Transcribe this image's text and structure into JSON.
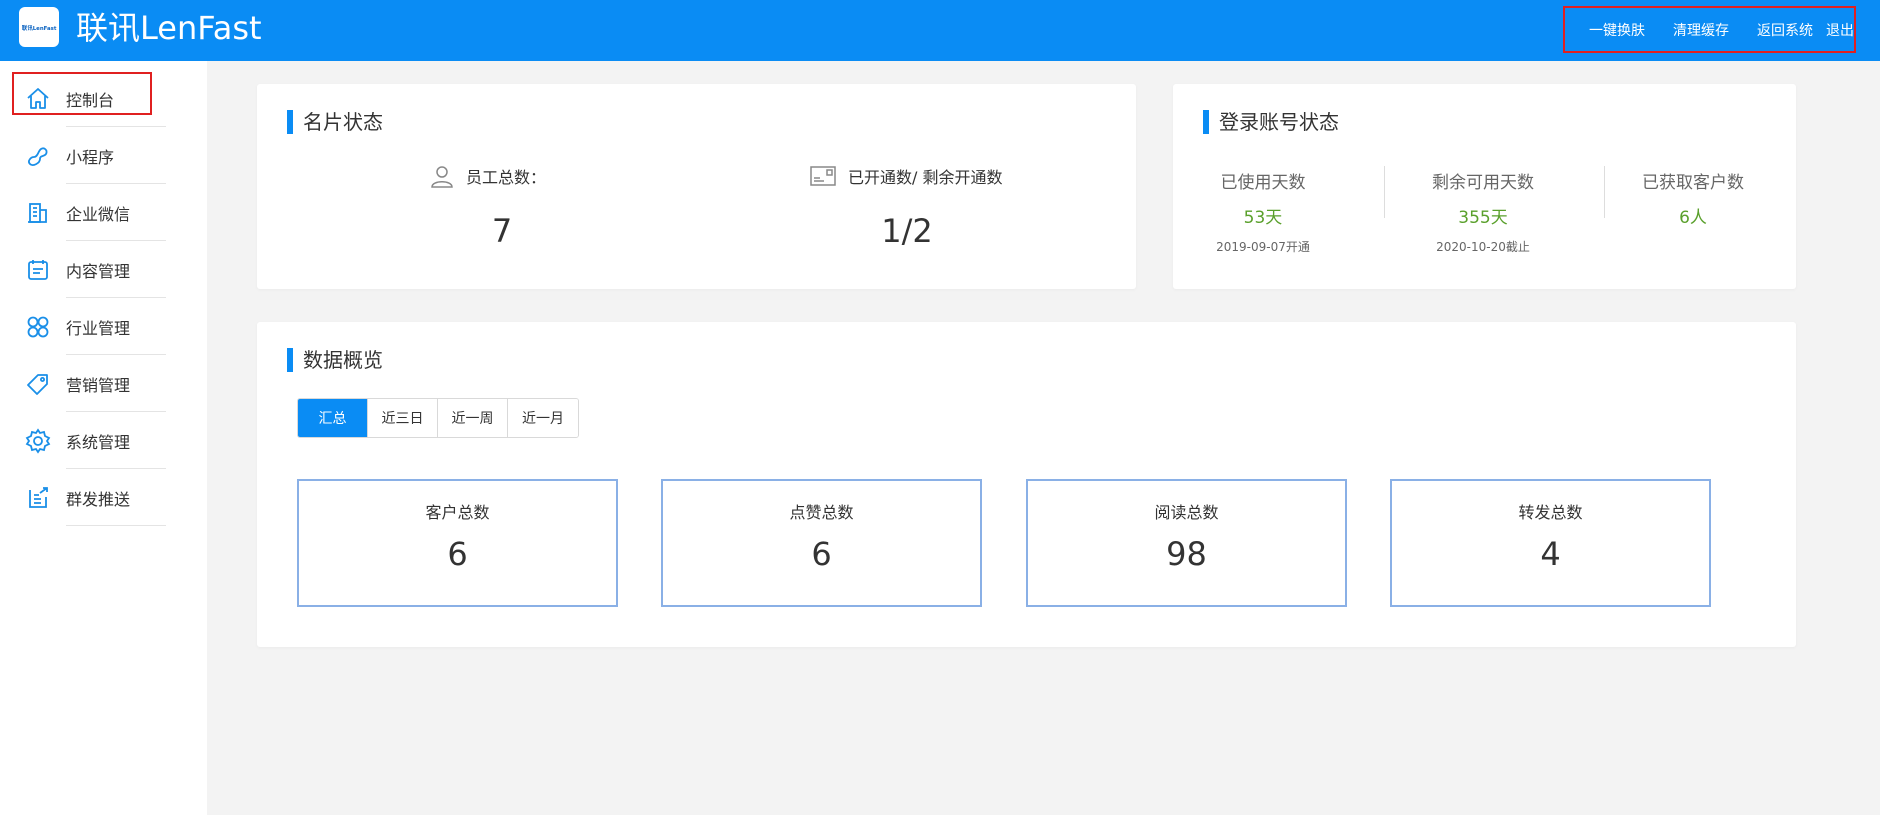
{
  "header": {
    "logo_text": "联讯LenFast",
    "brand": "联讯LenFast",
    "actions": [
      {
        "label": "一键换肤"
      },
      {
        "label": "清理缓存"
      },
      {
        "label": "返回系统"
      },
      {
        "label": "退出"
      }
    ]
  },
  "sidebar": {
    "items": [
      {
        "label": "控制台",
        "icon": "home-icon"
      },
      {
        "label": "小程序",
        "icon": "link-icon"
      },
      {
        "label": "企业微信",
        "icon": "building-icon"
      },
      {
        "label": "内容管理",
        "icon": "calendar-icon"
      },
      {
        "label": "行业管理",
        "icon": "grid-icon"
      },
      {
        "label": "营销管理",
        "icon": "tag-icon"
      },
      {
        "label": "系统管理",
        "icon": "gear-icon"
      },
      {
        "label": "群发推送",
        "icon": "send-icon"
      }
    ]
  },
  "card_status": {
    "title": "名片状态",
    "employees_label": "员工总数：",
    "employees_value": "7",
    "opened_label": "已开通数/ 剩余开通数",
    "opened_value": "1/2"
  },
  "account_status": {
    "title": "登录账号状态",
    "columns": [
      {
        "label": "已使用天数",
        "value": "53天",
        "sub": "2019-09-07开通"
      },
      {
        "label": "剩余可用天数",
        "value": "355天",
        "sub": "2020-10-20截止"
      },
      {
        "label": "已获取客户数",
        "value": "6人",
        "sub": ""
      }
    ]
  },
  "overview": {
    "title": "数据概览",
    "tabs": [
      "汇总",
      "近三日",
      "近一周",
      "近一月"
    ],
    "active_tab": 0,
    "metrics": [
      {
        "label": "客户总数",
        "value": "6"
      },
      {
        "label": "点赞总数",
        "value": "6"
      },
      {
        "label": "阅读总数",
        "value": "98"
      },
      {
        "label": "转发总数",
        "value": "4"
      }
    ]
  },
  "colors": {
    "brand_blue": "#0a8cf4",
    "highlight_red": "#e02020",
    "green_value": "#5aa02c",
    "metric_border": "#8ab0e6"
  }
}
